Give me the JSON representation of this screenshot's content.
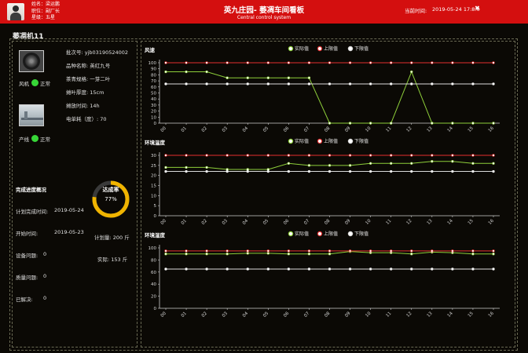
{
  "header": {
    "user_rows": [
      "姓名：梁运鹏",
      "职位：副厂长",
      "星级：五星"
    ],
    "title": "英九庄园- 萎凋车间看板",
    "subtitle": "Central control system",
    "time_label": "当前时间:",
    "time_value": "2019-05-24 17:8:0"
  },
  "section_title": "萎凋机11",
  "devices": [
    {
      "label": "风机",
      "status": "正常",
      "status_color": "#37d637"
    },
    {
      "label": "产线",
      "status": "正常",
      "status_color": "#37d637"
    }
  ],
  "batch_info": [
    "批次号: yjb03190524002",
    "品种名称:   英红九号",
    "茶青规格:   一芽二叶",
    "摊叶厚度:   15cm",
    "摊放时间:   14h",
    "电单耗（度）:   70"
  ],
  "progress": {
    "title": "完成进度概况",
    "rows": [
      {
        "label": "计划完成时间:",
        "value": "2019-05-24"
      },
      {
        "label": "开始时间:",
        "value": "2019-05-23"
      },
      {
        "label": "设备问题:",
        "value": "0"
      },
      {
        "label": "质量问题:",
        "value": "0"
      },
      {
        "label": "已解决:",
        "value": "0"
      }
    ],
    "ring_label": "达成率",
    "ring_value": "77%",
    "ring_fraction": 0.77,
    "plan_text": "计划量: 200 斤",
    "actual_text": "实际: 153 斤"
  },
  "legend": [
    "实际值",
    "上限值",
    "下限值"
  ],
  "colors": {
    "header_red": "#d40f0f",
    "actual": "#8ecf3a",
    "upper": "#e53030",
    "lower": "#dcdcdc",
    "ring": "#f0b400"
  },
  "chart_data": [
    {
      "type": "line",
      "title": "风速",
      "x": [
        "00",
        "01",
        "02",
        "03",
        "04",
        "05",
        "06",
        "07",
        "08",
        "09",
        "10",
        "11",
        "12",
        "13",
        "14",
        "15",
        "16"
      ],
      "ylim": [
        0,
        100
      ],
      "yticks": [
        0,
        10,
        20,
        30,
        40,
        50,
        60,
        70,
        80,
        90,
        100
      ],
      "grid": false,
      "legend_position": "top-center",
      "series": [
        {
          "name": "实际值",
          "values": [
            85,
            85,
            85,
            75,
            75,
            75,
            75,
            75,
            0,
            0,
            0,
            0,
            85,
            0,
            0,
            0,
            0
          ]
        },
        {
          "name": "上限值",
          "values": [
            100,
            100,
            100,
            100,
            100,
            100,
            100,
            100,
            100,
            100,
            100,
            100,
            100,
            100,
            100,
            100,
            100
          ]
        },
        {
          "name": "下限值",
          "values": [
            65,
            65,
            65,
            65,
            65,
            65,
            65,
            65,
            65,
            65,
            65,
            65,
            65,
            65,
            65,
            65,
            65
          ]
        }
      ]
    },
    {
      "type": "line",
      "title": "环境温度",
      "x": [
        "00",
        "01",
        "02",
        "03",
        "04",
        "05",
        "06",
        "07",
        "08",
        "09",
        "10",
        "11",
        "12",
        "13",
        "14",
        "15",
        "16"
      ],
      "ylim": [
        0,
        30
      ],
      "yticks": [
        0,
        5,
        10,
        15,
        20,
        25,
        30
      ],
      "grid": false,
      "legend_position": "top-center",
      "series": [
        {
          "name": "实际值",
          "values": [
            24,
            24,
            24,
            23,
            23,
            23,
            26,
            25,
            25,
            25,
            26,
            26,
            26,
            27,
            27,
            26,
            26
          ]
        },
        {
          "name": "上限值",
          "values": [
            30,
            30,
            30,
            30,
            30,
            30,
            30,
            30,
            30,
            30,
            30,
            30,
            30,
            30,
            30,
            30,
            30
          ]
        },
        {
          "name": "下限值",
          "values": [
            22,
            22,
            22,
            22,
            22,
            22,
            22,
            22,
            22,
            22,
            22,
            22,
            22,
            22,
            22,
            22,
            22
          ]
        }
      ]
    },
    {
      "type": "line",
      "title": "环境湿度",
      "x": [
        "00",
        "01",
        "02",
        "03",
        "04",
        "05",
        "06",
        "07",
        "08",
        "09",
        "10",
        "11",
        "12",
        "13",
        "14",
        "15",
        "16"
      ],
      "ylim": [
        0,
        100
      ],
      "yticks": [
        0,
        20,
        40,
        60,
        80,
        100
      ],
      "grid": false,
      "legend_position": "top-center",
      "series": [
        {
          "name": "实际值",
          "values": [
            90,
            90,
            90,
            90,
            91,
            91,
            90,
            90,
            90,
            94,
            92,
            92,
            90,
            93,
            92,
            90,
            90
          ]
        },
        {
          "name": "上限值",
          "values": [
            95,
            95,
            95,
            95,
            95,
            95,
            95,
            95,
            95,
            95,
            95,
            95,
            95,
            95,
            95,
            95,
            95
          ]
        },
        {
          "name": "下限值",
          "values": [
            65,
            65,
            65,
            65,
            65,
            65,
            65,
            65,
            65,
            65,
            65,
            65,
            65,
            65,
            65,
            65,
            65
          ]
        }
      ]
    }
  ]
}
